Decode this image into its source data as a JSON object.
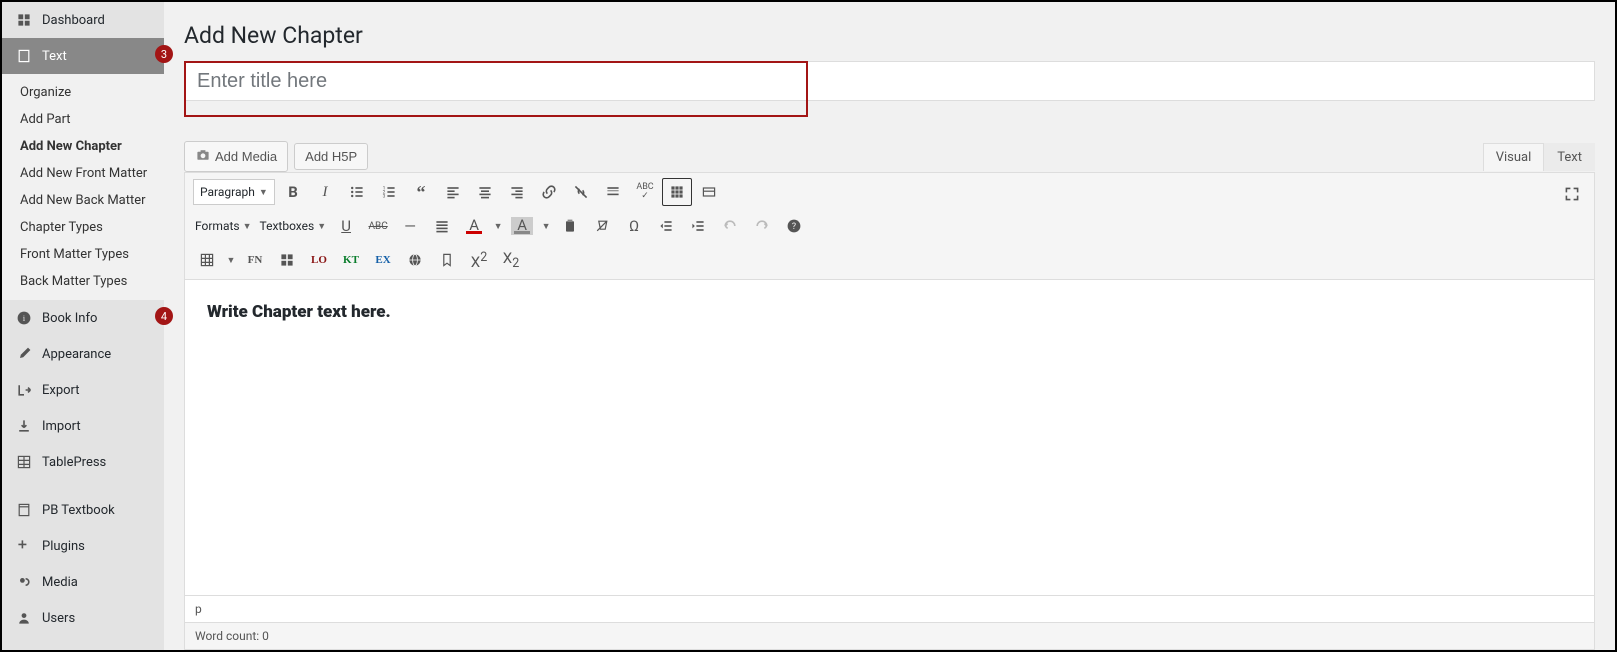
{
  "sidebar": {
    "dashboard": "Dashboard",
    "text": "Text",
    "submenu": {
      "organize": "Organize",
      "add_part": "Add Part",
      "add_new_chapter": "Add New Chapter",
      "add_new_front_matter": "Add New Front Matter",
      "add_new_back_matter": "Add New Back Matter",
      "chapter_types": "Chapter Types",
      "front_matter_types": "Front Matter Types",
      "back_matter_types": "Back Matter Types"
    },
    "book_info": "Book Info",
    "appearance": "Appearance",
    "export": "Export",
    "import": "Import",
    "tablepress": "TablePress",
    "pb_textbook": "PB Textbook",
    "plugins": "Plugins",
    "media": "Media",
    "users": "Users"
  },
  "badges": {
    "text": "3",
    "book_info": "4"
  },
  "page": {
    "title": "Add New Chapter",
    "title_placeholder": "Enter title here"
  },
  "media_buttons": {
    "add_media": "Add Media",
    "add_h5p": "Add H5P"
  },
  "tabs": {
    "visual": "Visual",
    "text": "Text"
  },
  "toolbar": {
    "paragraph": "Paragraph",
    "formats": "Formats",
    "textboxes": "Textboxes",
    "fn": "FN",
    "lo": "LO",
    "kt": "KT",
    "ex": "EX"
  },
  "editor": {
    "placeholder": "Write Chapter text here.",
    "path": "p",
    "word_count": "Word count: 0"
  }
}
